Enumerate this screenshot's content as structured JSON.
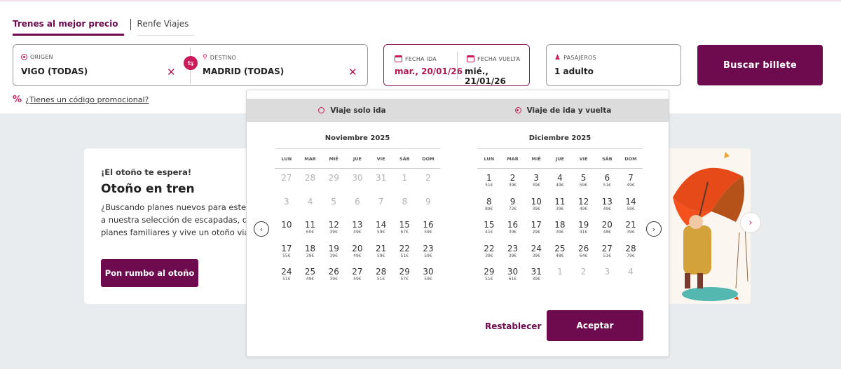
{
  "tabs": [
    {
      "label": "Trenes al mejor precio",
      "active": true
    },
    {
      "label": "Renfe Viajes",
      "active": false
    }
  ],
  "search": {
    "origin": {
      "label": "ORIGEN",
      "value": "VIGO (TODAS)"
    },
    "destination": {
      "label": "DESTINO",
      "value": "MADRID (TODAS)"
    },
    "date_out": {
      "label": "FECHA IDA",
      "value": "mar., 20/01/26"
    },
    "date_return": {
      "label": "FECHA VUELTA",
      "value": "mié., 21/01/26"
    },
    "passengers": {
      "label": "PASAJEROS",
      "value": "1 adulto"
    },
    "search_button": "Buscar billete",
    "promo_icon": "%",
    "promo_link": "¿Tienes un código promocional?",
    "clear_glyph": "✕",
    "swap_glyph": "⇆"
  },
  "promo_card": {
    "kicker": "¡El otoño te espera!",
    "title": "Otoño en tren",
    "description_lines": [
      "¿Buscando planes nuevos para este ot",
      "a nuestra selección de escapadas, des",
      "planes familiares y vive un otoño viajer"
    ],
    "cta": "Pon rumbo al otoño"
  },
  "carousel": {
    "next_glyph": "›"
  },
  "calendar": {
    "trip_types": [
      {
        "label": "Viaje solo ida",
        "selected": false
      },
      {
        "label": "Viaje de ida y vuelta",
        "selected": true
      }
    ],
    "weekdays": [
      "LUN",
      "MAR",
      "MIÉ",
      "JUE",
      "VIE",
      "SÁB",
      "DOM"
    ],
    "prev_glyph": "‹",
    "next_glyph": "›",
    "months": [
      {
        "title": "Noviembre  2025",
        "weeks": [
          [
            {
              "d": "27",
              "p": "",
              "dis": true
            },
            {
              "d": "28",
              "p": "",
              "dis": true
            },
            {
              "d": "29",
              "p": "",
              "dis": true
            },
            {
              "d": "30",
              "p": "",
              "dis": true
            },
            {
              "d": "31",
              "p": "",
              "dis": true
            },
            {
              "d": "1",
              "p": "",
              "dis": true
            },
            {
              "d": "2",
              "p": "",
              "dis": true
            }
          ],
          [
            {
              "d": "3",
              "p": "",
              "dis": true
            },
            {
              "d": "4",
              "p": "",
              "dis": true
            },
            {
              "d": "5",
              "p": "",
              "dis": true
            },
            {
              "d": "6",
              "p": "",
              "dis": true
            },
            {
              "d": "7",
              "p": "",
              "dis": true
            },
            {
              "d": "8",
              "p": "",
              "dis": true
            },
            {
              "d": "9",
              "p": "",
              "dis": true
            }
          ],
          [
            {
              "d": "10",
              "p": ""
            },
            {
              "d": "11",
              "p": "60€"
            },
            {
              "d": "12",
              "p": "39€"
            },
            {
              "d": "13",
              "p": "49€"
            },
            {
              "d": "14",
              "p": "59€"
            },
            {
              "d": "15",
              "p": "67€"
            },
            {
              "d": "16",
              "p": "59€"
            }
          ],
          [
            {
              "d": "17",
              "p": "55€"
            },
            {
              "d": "18",
              "p": "39€"
            },
            {
              "d": "19",
              "p": "39€"
            },
            {
              "d": "20",
              "p": "49€"
            },
            {
              "d": "21",
              "p": "59€"
            },
            {
              "d": "22",
              "p": "51€"
            },
            {
              "d": "23",
              "p": "59€"
            }
          ],
          [
            {
              "d": "24",
              "p": "51€"
            },
            {
              "d": "25",
              "p": "49€"
            },
            {
              "d": "26",
              "p": "39€"
            },
            {
              "d": "27",
              "p": "49€"
            },
            {
              "d": "28",
              "p": "51€"
            },
            {
              "d": "29",
              "p": "57€"
            },
            {
              "d": "30",
              "p": "59€"
            }
          ]
        ]
      },
      {
        "title": "Diciembre  2025",
        "weeks": [
          [
            {
              "d": "1",
              "p": "51€"
            },
            {
              "d": "2",
              "p": "39€"
            },
            {
              "d": "3",
              "p": "39€"
            },
            {
              "d": "4",
              "p": "49€"
            },
            {
              "d": "5",
              "p": "59€"
            },
            {
              "d": "6",
              "p": "51€"
            },
            {
              "d": "7",
              "p": "49€"
            }
          ],
          [
            {
              "d": "8",
              "p": "89€"
            },
            {
              "d": "9",
              "p": "72€"
            },
            {
              "d": "10",
              "p": "39€"
            },
            {
              "d": "11",
              "p": "39€"
            },
            {
              "d": "12",
              "p": "49€"
            },
            {
              "d": "13",
              "p": "49€"
            },
            {
              "d": "14",
              "p": "59€"
            }
          ],
          [
            {
              "d": "15",
              "p": "41€"
            },
            {
              "d": "16",
              "p": "39€"
            },
            {
              "d": "17",
              "p": "29€"
            },
            {
              "d": "18",
              "p": "39€"
            },
            {
              "d": "19",
              "p": "41€"
            },
            {
              "d": "20",
              "p": "48€"
            },
            {
              "d": "21",
              "p": "39€"
            }
          ],
          [
            {
              "d": "22",
              "p": "39€"
            },
            {
              "d": "23",
              "p": "39€"
            },
            {
              "d": "24",
              "p": "39€"
            },
            {
              "d": "25",
              "p": "48€"
            },
            {
              "d": "26",
              "p": "64€"
            },
            {
              "d": "27",
              "p": "51€"
            },
            {
              "d": "28",
              "p": "79€"
            }
          ],
          [
            {
              "d": "29",
              "p": "51€"
            },
            {
              "d": "30",
              "p": "61€"
            },
            {
              "d": "31",
              "p": "39€"
            },
            {
              "d": "1",
              "p": "",
              "dis": true
            },
            {
              "d": "2",
              "p": "",
              "dis": true
            },
            {
              "d": "3",
              "p": "",
              "dis": true
            },
            {
              "d": "4",
              "p": "",
              "dis": true
            }
          ]
        ]
      }
    ],
    "reset_label": "Restablecer",
    "accept_label": "Aceptar"
  },
  "colors": {
    "brand": "#6e0a4e",
    "accent": "#c81d5a"
  }
}
